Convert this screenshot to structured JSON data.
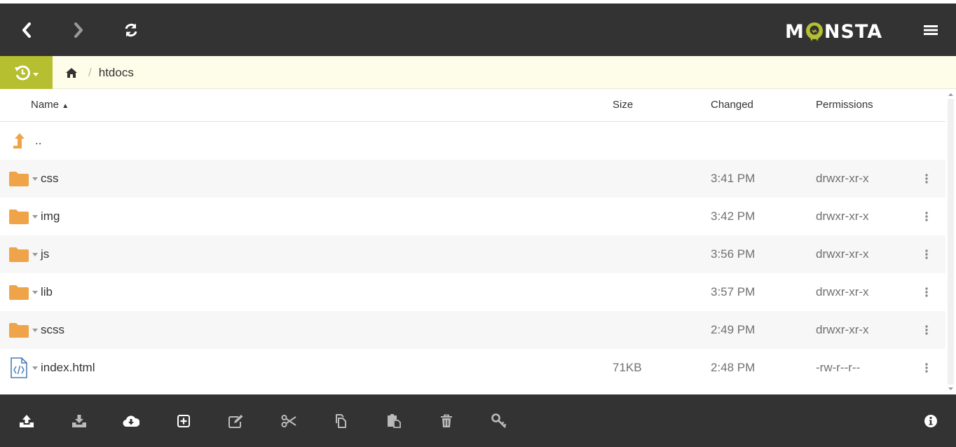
{
  "app": {
    "logo_text_left": "M",
    "logo_text_right": "NSTA"
  },
  "header": {
    "back_icon": "chevron-left-icon",
    "forward_icon": "chevron-right-icon",
    "refresh_icon": "refresh-icon",
    "menu_icon": "hamburger-menu-icon"
  },
  "breadcrumb": {
    "separator": "/",
    "current": "htdocs"
  },
  "columns": {
    "name": "Name",
    "size": "Size",
    "changed": "Changed",
    "permissions": "Permissions"
  },
  "parent_row": {
    "label": ".."
  },
  "files": [
    {
      "name": "css",
      "type": "folder",
      "size": "",
      "changed": "3:41 PM",
      "permissions": "drwxr-xr-x"
    },
    {
      "name": "img",
      "type": "folder",
      "size": "",
      "changed": "3:42 PM",
      "permissions": "drwxr-xr-x"
    },
    {
      "name": "js",
      "type": "folder",
      "size": "",
      "changed": "3:56 PM",
      "permissions": "drwxr-xr-x"
    },
    {
      "name": "lib",
      "type": "folder",
      "size": "",
      "changed": "3:57 PM",
      "permissions": "drwxr-xr-x"
    },
    {
      "name": "scss",
      "type": "folder",
      "size": "",
      "changed": "2:49 PM",
      "permissions": "drwxr-xr-x"
    },
    {
      "name": "index.html",
      "type": "file",
      "size": "71KB",
      "changed": "2:48 PM",
      "permissions": "-rw-r--r--"
    }
  ],
  "toolbar": [
    "upload-icon",
    "download-icon",
    "cloud-download-icon",
    "new-item-icon",
    "edit-icon",
    "cut-icon",
    "copy-icon",
    "paste-icon",
    "delete-icon",
    "key-icon",
    "info-icon"
  ],
  "colors": {
    "header_bg": "#333333",
    "accent_green": "#b5bf30",
    "folder_orange": "#f0a44a",
    "crumb_bg": "#fdfdea"
  }
}
